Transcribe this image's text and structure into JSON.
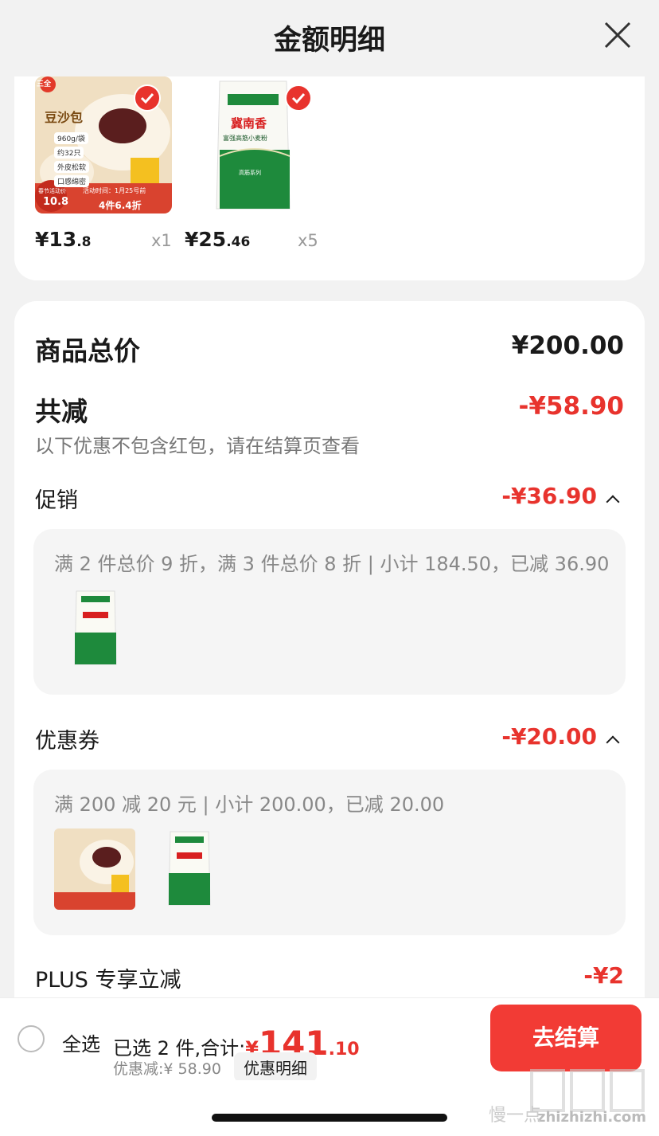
{
  "header": {
    "title": "金额明细"
  },
  "items": [
    {
      "name": "豆沙包",
      "price_int": "¥13",
      "price_dec": ".8",
      "qty": "x1",
      "img_text_brand": "三全",
      "img_text_title": "豆沙包",
      "img_text_spec": "960g/袋",
      "img_text_count": "约32只",
      "img_text_promo": "4件6.4折",
      "img_text_price": "10.8",
      "img_text_event": "活动时间：1月25号前",
      "img_text_feature1": "外皮松软",
      "img_text_feature2": "口感绵密",
      "img_text_tag": "春节活动价"
    },
    {
      "name": "面粉",
      "price_int": "¥25",
      "price_dec": ".46",
      "qty": "x5",
      "img_text_brand": "冀南香",
      "img_text_title": "富强高筋小麦粉",
      "img_text_series": "高筋系列"
    }
  ],
  "summary": {
    "total_label": "商品总价",
    "total_value": "¥200.00",
    "reduce_label": "共减",
    "reduce_value": "-¥58.90",
    "note": "以下优惠不包含红包，请在结算页查看"
  },
  "promo": {
    "label": "促销",
    "value": "-¥36.90",
    "detail": "满 2 件总价 9 折，满 3 件总价 8 折 | 小计 184.50，已减 36.90"
  },
  "coupon": {
    "label": "优惠券",
    "value": "-¥20.00",
    "detail": "满 200 减 20 元 | 小计 200.00，已减 20.00"
  },
  "plus": {
    "label": "PLUS 专享立减",
    "value": "-¥2"
  },
  "bottom": {
    "select_all": "全选",
    "selected_prefix": "已选 2 件,合计:",
    "total_symbol": "¥",
    "total_int": "141",
    "total_dec": ".10",
    "discount": "优惠减:¥ 58.90",
    "detail_link": "优惠明细",
    "checkout": "去结算"
  },
  "watermark": {
    "text": "zhizhizhi.com",
    "side_text": "慢一点"
  },
  "colors": {
    "accent": "#e8332d",
    "button": "#f23b35",
    "green": "#1e8a3c"
  }
}
